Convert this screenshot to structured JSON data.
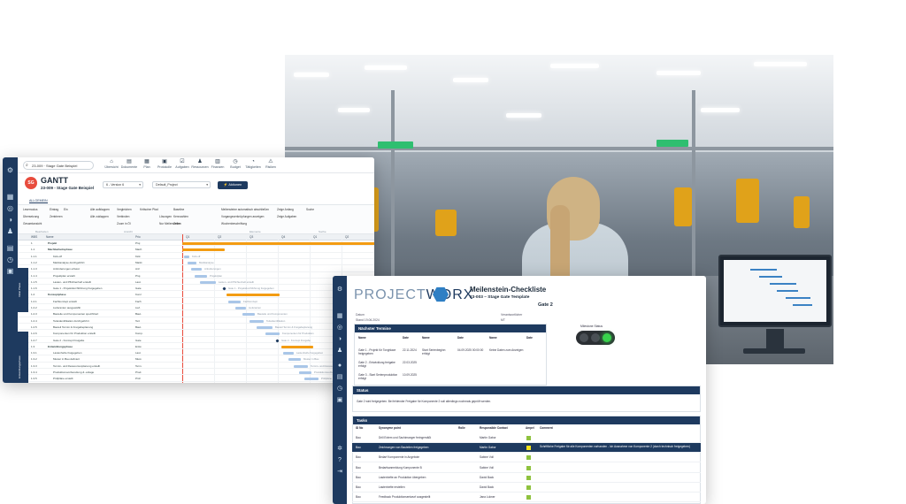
{
  "gantt": {
    "search": "23-009 · Stage Gate Beispiel",
    "nav": [
      {
        "icon": "⌂",
        "label": "Übersicht"
      },
      {
        "icon": "▤",
        "label": "Dokumente"
      },
      {
        "icon": "▦",
        "label": "Plan"
      },
      {
        "icon": "▣",
        "label": "Protokolle"
      },
      {
        "icon": "☑",
        "label": "Aufgaben"
      },
      {
        "icon": "♟",
        "label": "Ressourcen"
      },
      {
        "icon": "▥",
        "label": "Finanzen"
      },
      {
        "icon": "◷",
        "label": "Budget"
      },
      {
        "icon": "◔",
        "label": "Tätigkeiten"
      },
      {
        "icon": "⚠",
        "label": "Risiken"
      }
    ],
    "badge": "SG",
    "title": "GANTT",
    "subtitle": "23-009 - Stage Gate Beispiel",
    "version_select": "6 - Version 6",
    "project_select": "Default_Project",
    "action_button": "Aktionen",
    "tab": "ALLGEMEIN",
    "tools": [
      "Lesemodus",
      "Übersetzung",
      "Gesamtansicht",
      "Eintrag",
      "Zentrieren",
      "Ein",
      "Alle aufklappen",
      "Alle zuklappen",
      "Vergleichen",
      "Verbinden",
      "Zoom in Öl",
      "Kritischer Pfad",
      "Baseline",
      "Lösungen",
      "Kennzahlen",
      "Nur Meilensteine",
      "Zeilen",
      "Meilensteine automatisch abschließen",
      "Vorgangsverknüpfungen anzeigen",
      "Wochenbeschriftung",
      "Zeige Anfang",
      "Zeige Aufgaben",
      "Suche"
    ],
    "groups": [
      "Bearbeiten",
      "Ansicht",
      "Elemente",
      "Suche"
    ],
    "columns": [
      "WBS",
      "Name",
      "Prio"
    ],
    "timeline": [
      "Q1",
      "Q2",
      "Q3",
      "Q4",
      "Q1",
      "Q2"
    ],
    "years": [
      "2024",
      "2025"
    ],
    "phases": [
      "Initial Phase",
      "Entwicklungsphase"
    ],
    "rows": [
      {
        "wbs": "1",
        "name": "Projekt",
        "prio": "Proj"
      },
      {
        "wbs": "1.1",
        "name": "Machbarkeitsphase",
        "prio": "Mach"
      },
      {
        "wbs": "1.1.1",
        "name": "Kick-off",
        "prio": "Kick"
      },
      {
        "wbs": "1.1.2",
        "name": "Marktanalyse durchgeführt",
        "prio": "Markt"
      },
      {
        "wbs": "1.1.3",
        "name": "Anforderungen erfasst",
        "prio": "Anf."
      },
      {
        "wbs": "1.1.4",
        "name": "Projektplan erstellt",
        "prio": "Proj."
      },
      {
        "wbs": "1.1.5",
        "name": "Lasten- und Pflichtenheft erstellt",
        "prio": "Last."
      },
      {
        "wbs": "1.1.6",
        "name": "Gate 1 - Projektdurchführung freigegeben",
        "prio": "Gate"
      },
      {
        "wbs": "1.2",
        "name": "Konzeptphase",
        "prio": "Konz"
      },
      {
        "wbs": "1.2.1",
        "name": "Fachkonzept erstellt",
        "prio": "Fach"
      },
      {
        "wbs": "1.2.2",
        "name": "Lieferanten ausgewählt",
        "prio": "Lief."
      },
      {
        "wbs": "1.2.3",
        "name": "Bauteile und Komponenten spezifiziert",
        "prio": "Baut."
      },
      {
        "wbs": "1.2.4",
        "name": "Teileidentifikation durchgeführt",
        "prio": "Teil."
      },
      {
        "wbs": "1.2.5",
        "name": "Bauteil Termin & Freigabeplanung",
        "prio": "Baut."
      },
      {
        "wbs": "1.2.6",
        "name": "Komponenten für Produktion erstellt",
        "prio": "Komp."
      },
      {
        "wbs": "1.2.7",
        "name": "Gate 2 - Konzept Freigabe",
        "prio": "Gate"
      },
      {
        "wbs": "1.3",
        "name": "Entwicklungsphase",
        "prio": "Entw"
      },
      {
        "wbs": "1.3.1",
        "name": "Lastenhefte freigegeben",
        "prio": "Last."
      },
      {
        "wbs": "1.3.2",
        "name": "Muster in Bau definiert",
        "prio": "Must."
      },
      {
        "wbs": "1.3.3",
        "name": "Termin- und Ressourcenplanung erstellt",
        "prio": "Term."
      },
      {
        "wbs": "1.3.4",
        "name": "Produktionsvorbereitung & -anlage",
        "prio": "Prod."
      },
      {
        "wbs": "1.3.5",
        "name": "Prüfpläne erstellt",
        "prio": "Prüf."
      }
    ],
    "bar_labels": [
      "Kick-off",
      "Marktanalyse",
      "Anforderungen",
      "Projektplan",
      "Lasten- und Pflichtenheft erstellt",
      "Gate 1 - Projektdurchführung freigegeben",
      "Fachkonzept",
      "Lieferanten",
      "Bauteile und Komponenten",
      "Teileidentifikation",
      "Bauteil Termin & Freigabeplanung",
      "Komponenten für Produktion",
      "Gate 2 - Konzept Freigabe",
      "Lastenhefte freigegeben",
      "Muster in Bau",
      "Termin- und Ressourcenplanung",
      "Produktionsvorbereitung",
      "Prüfpläne erstellt"
    ],
    "colors": {
      "summary": "#f39c12",
      "task": "#a9c6e8",
      "milestone": "#1e3a5f",
      "today": "#e84c3d"
    }
  },
  "checklist": {
    "logo_a": "PROJECT",
    "logo_b": "WORX",
    "title": "Meilenstein-Checkliste",
    "subtitle": "23-003 – Stage Gate Template",
    "gate": "Gate 2",
    "meta": [
      {
        "label": "Datum",
        "value": "Stand 19.06.2024"
      },
      {
        "label": "Verantwortlicher",
        "value": "MT"
      }
    ],
    "next_dates": {
      "heading": "Nächster Termine",
      "col1": [
        "Name",
        "Gate 1 - Projekt für Tonghlace freigegeben",
        "Gate 2 - Entwicklung freigabe erfolgt",
        "Gate 3 - Start Serienproduktion erfolgt"
      ],
      "col2": [
        "Date",
        "22.11.2024",
        "22.03.2025",
        "10.09.2025"
      ],
      "col3": [
        "Name",
        "Start Serienbeginn erfolgt"
      ],
      "col4": [
        "Date",
        "04.09.2025 00:00:00"
      ],
      "col5": [
        "Name",
        "Keine Daten zum Anzeigen"
      ],
      "col6": [
        "Date"
      ]
    },
    "milestone_status": "Milestone Status",
    "status": {
      "heading": "Status",
      "text": "Gate 2 wird freigegeben. Bei fehlender Freigabe für Komponente 2 soll allerdings nochmals geprüft werden."
    },
    "tasks": {
      "heading": "Tasks",
      "columns": [
        "ID No",
        "Synonyme point",
        "Rolle",
        "Responsible Contact",
        "Ampel",
        "Comment"
      ],
      "rows": [
        {
          "id": "Bau",
          "name": "Drill Extem und Sachimanger freingemäßt",
          "role": "",
          "contact": "Martin Gabor",
          "comment": "",
          "light": "#8fc23f",
          "selected": false
        },
        {
          "id": "Bau",
          "name": "Zeichnungen von Bauteilen freigegeben",
          "role": "",
          "contact": "Martin Gabor",
          "comment": "Schriftliche Freigabe für alle Komponenten vorhanden - Ich Ausnahme von Komponente 2 (durch technisch freigegeben)",
          "light": "#f2e21b",
          "selected": true
        },
        {
          "id": "Bau",
          "name": "Bedarf Komponente in Angebote",
          "role": "",
          "contact": "Sabine Voll",
          "comment": "",
          "light": "#8fc23f",
          "selected": false
        },
        {
          "id": "Bau",
          "name": "Bedarfsanmeldung Komponente B",
          "role": "",
          "contact": "Sabine Voll",
          "comment": "",
          "light": "#8fc23f",
          "selected": false
        },
        {
          "id": "Bau",
          "name": "Lastenhefte an Produktion übergeben",
          "role": "",
          "contact": "David Back",
          "comment": "",
          "light": "#8fc23f",
          "selected": false
        },
        {
          "id": "Bau",
          "name": "Lastenhefte erstellen",
          "role": "",
          "contact": "David Back",
          "comment": "",
          "light": "#8fc23f",
          "selected": false
        },
        {
          "id": "Bau",
          "name": "Feedback Produktionsentwurf ausgestellt",
          "role": "",
          "contact": "Jana Lukner",
          "comment": "",
          "light": "#8fc23f",
          "selected": false
        }
      ]
    },
    "traffic_colors": {
      "off": "#4a4f55",
      "green": "#38d14c"
    }
  }
}
